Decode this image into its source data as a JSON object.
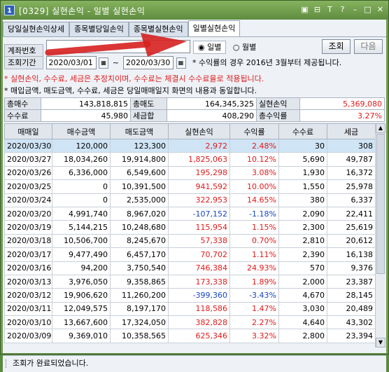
{
  "window": {
    "screen_number": "1",
    "title": "[0329] 실현손익 - 일별 실현손익",
    "controls": [
      "▣",
      "⊟",
      "T",
      "?",
      "–",
      "□",
      "✕"
    ]
  },
  "tabs": [
    {
      "label": "당일실현손익상세",
      "active": false
    },
    {
      "label": "종목별당일손익",
      "active": false
    },
    {
      "label": "종목별실현손익",
      "active": false
    },
    {
      "label": "일별실현손익",
      "active": true
    }
  ],
  "form": {
    "account_label": "계좌번호",
    "account_value": "",
    "period_label": "조회기간",
    "start_date": "2020/03/01",
    "tilde": "~",
    "end_date": "2020/03/30",
    "calendar_icon": "calendar-icon",
    "radio_daily": "일별",
    "radio_monthly": "월별",
    "search_button": "조회",
    "next_button": "다음",
    "period_note": "* 수익률의 경우 2016년 3월부터 제공됩니다."
  },
  "notes": {
    "line1": "* 실현손익, 수수료, 세금은 추정치이며, 수수료는 체결시 수수료율로 적용됩니다.",
    "line2": "* 매입금액, 매도금액, 수수료, 세금은 당일매매일지 화면의 내용과 동일합니다."
  },
  "summary": {
    "buy_total_label": "총매수",
    "buy_total": "143,818,815",
    "sell_total_label": "총매도",
    "sell_total": "164,345,325",
    "realized_label": "실현손익",
    "realized": "5,369,080",
    "fee_label": "수수료",
    "fee": "45,980",
    "tax_label": "세금합",
    "tax": "408,290",
    "return_label": "총수익률",
    "return": "3.27%"
  },
  "grid": {
    "headers": [
      "매매일",
      "매수금액",
      "매도금액",
      "실현손익",
      "수익률",
      "수수료",
      "세금"
    ],
    "rows": [
      [
        "2020/03/30",
        "120,000",
        "123,300",
        "2,972",
        "2.48%",
        "30",
        "308"
      ],
      [
        "2020/03/27",
        "18,034,260",
        "19,914,800",
        "1,825,063",
        "10.12%",
        "5,690",
        "49,787"
      ],
      [
        "2020/03/26",
        "6,336,000",
        "6,549,600",
        "195,298",
        "3.08%",
        "1,930",
        "16,372"
      ],
      [
        "2020/03/25",
        "0",
        "10,391,500",
        "941,592",
        "10.00%",
        "1,550",
        "25,978"
      ],
      [
        "2020/03/24",
        "0",
        "2,535,000",
        "322,953",
        "14.65%",
        "380",
        "6,337"
      ],
      [
        "2020/03/20",
        "4,991,740",
        "8,967,020",
        "-107,152",
        "-1.18%",
        "2,090",
        "22,411"
      ],
      [
        "2020/03/19",
        "5,144,215",
        "10,248,680",
        "115,954",
        "1.15%",
        "2,300",
        "25,619"
      ],
      [
        "2020/03/18",
        "10,506,700",
        "8,245,670",
        "57,338",
        "0.70%",
        "2,810",
        "20,612"
      ],
      [
        "2020/03/17",
        "9,477,490",
        "6,457,170",
        "70,702",
        "1.11%",
        "2,390",
        "16,138"
      ],
      [
        "2020/03/16",
        "94,200",
        "3,750,540",
        "746,384",
        "24.93%",
        "570",
        "9,376"
      ],
      [
        "2020/03/13",
        "3,976,050",
        "9,358,865",
        "173,338",
        "1.89%",
        "2,000",
        "23,387"
      ],
      [
        "2020/03/12",
        "19,906,620",
        "11,260,200",
        "-399,360",
        "-3.43%",
        "4,670",
        "28,145"
      ],
      [
        "2020/03/11",
        "12,049,575",
        "8,197,170",
        "118,586",
        "1.47%",
        "3,030",
        "20,489"
      ],
      [
        "2020/03/10",
        "13,667,600",
        "17,324,050",
        "382,828",
        "2.27%",
        "4,640",
        "43,302"
      ],
      [
        "2020/03/09",
        "9,369,010",
        "10,358,565",
        "625,346",
        "3.32%",
        "2,800",
        "23,394"
      ]
    ]
  },
  "status": {
    "message": "조회가 완료되었습니다."
  },
  "colors": {
    "profit": "#e01a1a",
    "loss": "#1646c9",
    "selected_row": "#cfe4f5",
    "frame": "#6f9a4e",
    "annotation_arrow": "#d62020"
  }
}
